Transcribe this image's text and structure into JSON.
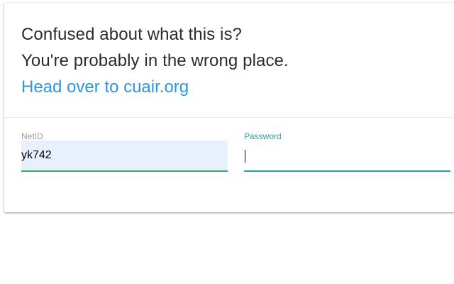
{
  "intro": {
    "line1": "Confused about what this is?",
    "line2": "You're probably in the wrong place.",
    "link_text": "Head over to cuair.org"
  },
  "login": {
    "netid": {
      "label": "NetID",
      "value": "yk742"
    },
    "password": {
      "label": "Password",
      "value": ""
    }
  },
  "colors": {
    "link": "#2a96e0",
    "autofill_background": "#e8f0fe",
    "netid_underline": "#27ae60",
    "focus_accent": "#1aa89a",
    "label_inactive": "#9e9e9e"
  }
}
